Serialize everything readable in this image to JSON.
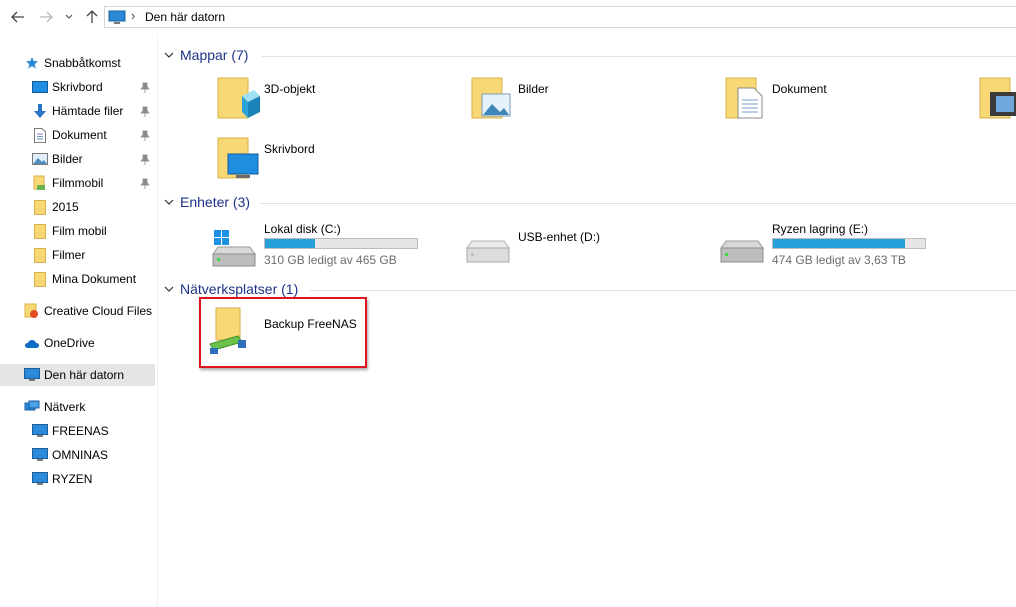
{
  "address": {
    "crumbs": [
      "Den här datorn"
    ]
  },
  "nav": {
    "quick_access": "Snabbåtkomst",
    "items": [
      {
        "label": "Skrivbord",
        "pinned": true
      },
      {
        "label": "Hämtade filer",
        "pinned": true
      },
      {
        "label": "Dokument",
        "pinned": true
      },
      {
        "label": "Bilder",
        "pinned": true
      },
      {
        "label": "Filmmobil",
        "pinned": true
      },
      {
        "label": "2015",
        "pinned": false
      },
      {
        "label": "Film mobil",
        "pinned": false
      },
      {
        "label": "Filmer",
        "pinned": false
      },
      {
        "label": "Mina Dokument",
        "pinned": false
      }
    ],
    "creative_cloud": "Creative Cloud Files",
    "onedrive": "OneDrive",
    "this_pc": "Den här datorn",
    "network": "Nätverk",
    "network_items": [
      "FREENAS",
      "OMNINAS",
      "RYZEN"
    ]
  },
  "groups": {
    "folders": "Mappar (7)",
    "devices": "Enheter (3)",
    "network": "Nätverksplatser (1)"
  },
  "folders": [
    "3D-objekt",
    "Bilder",
    "Dokument",
    "Skrivbord"
  ],
  "drives": [
    {
      "label": "Lokal disk (C:)",
      "free": "310 GB ledigt av 465 GB",
      "used_fraction": 0.33
    },
    {
      "label": "USB-enhet (D:)"
    },
    {
      "label": "Ryzen lagring (E:)",
      "free": "474 GB ledigt av 3,63 TB",
      "used_fraction": 0.87
    }
  ],
  "network_locations": [
    "Backup FreeNAS"
  ],
  "colors": {
    "group_header": "#1e3287",
    "bar_fill": "#26a0da",
    "highlight_box": "#e0141e",
    "folder": "#f8d775"
  }
}
